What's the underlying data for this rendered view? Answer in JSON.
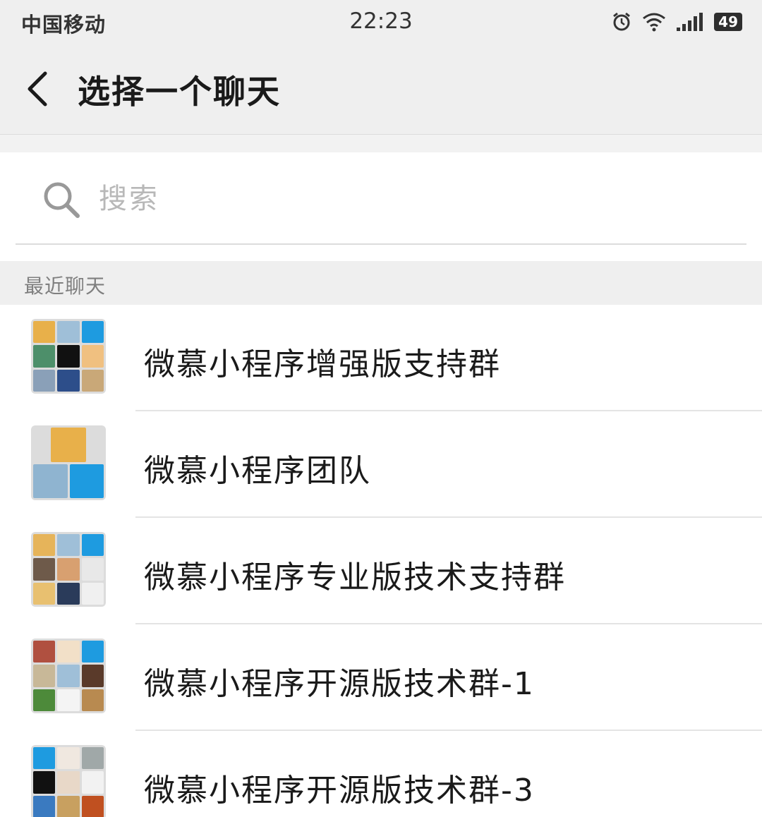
{
  "status_bar": {
    "carrier": "中国移动",
    "time": "22:23",
    "battery": "49"
  },
  "header": {
    "title": "选择一个聊天"
  },
  "search": {
    "placeholder": "搜索"
  },
  "section": {
    "title": "最近聊天"
  },
  "chats": [
    {
      "name": "微慕小程序增强版支持群"
    },
    {
      "name": "微慕小程序团队"
    },
    {
      "name": "微慕小程序专业版技术支持群"
    },
    {
      "name": "微慕小程序开源版技术群-1"
    },
    {
      "name": "微慕小程序开源版技术群-3"
    }
  ]
}
